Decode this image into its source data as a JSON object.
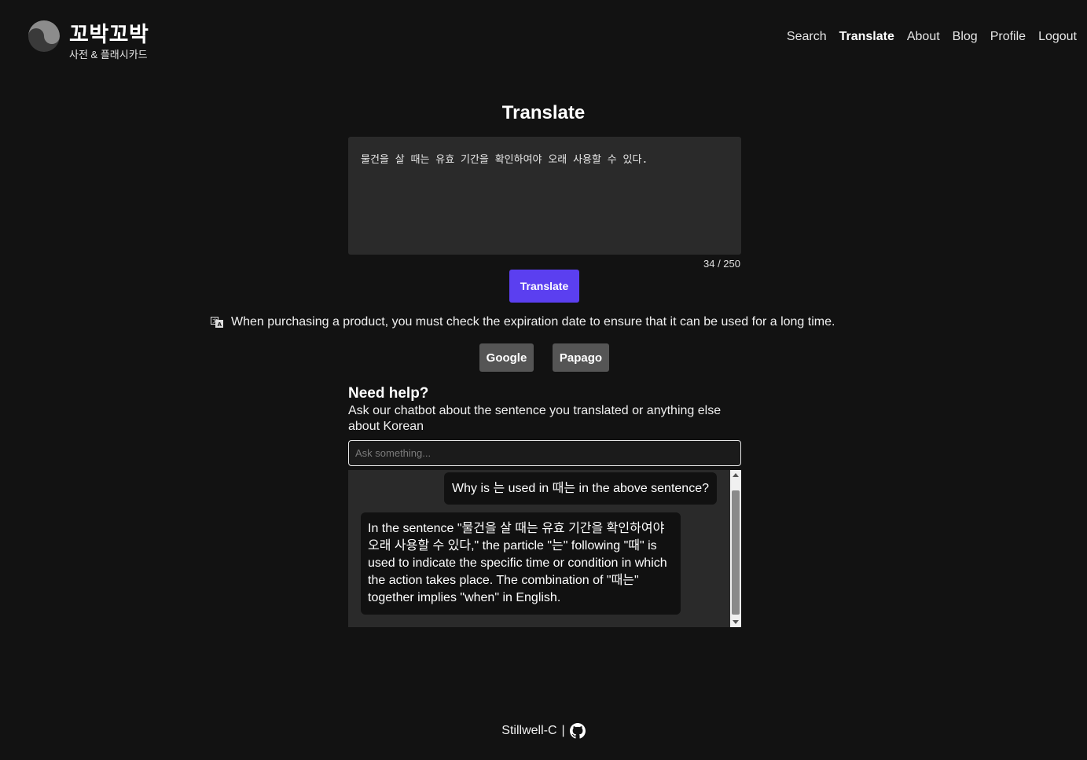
{
  "header": {
    "brand_title": "꼬박꼬박",
    "brand_subtitle": "사전 & 플래시카드",
    "nav": {
      "search": "Search",
      "translate": "Translate",
      "about": "About",
      "blog": "Blog",
      "profile": "Profile",
      "logout": "Logout"
    },
    "active_nav": "Translate"
  },
  "main": {
    "title": "Translate",
    "input_text": "물건을 살 때는 유효 기간을 확인하여야 오래 사용할 수 있다.",
    "char_counter": "34 / 250",
    "translate_button": "Translate",
    "translation_icon": "translate-icon",
    "translation_result": "When purchasing a product, you must check the expiration date to ensure that it can be used for a long time.",
    "service_buttons": {
      "google": "Google",
      "papago": "Papago"
    }
  },
  "help": {
    "title": "Need help?",
    "subtitle": "Ask our chatbot about the sentence you translated or anything else about Korean",
    "input_placeholder": "Ask something...",
    "messages": [
      {
        "role": "user",
        "text": "Why is 는 used in 때는 in the above sentence?"
      },
      {
        "role": "bot",
        "text": "In the sentence \"물건을 살 때는 유효 기간을 확인하여야 오래 사용할 수 있다,\" the particle \"는\" following \"때\" is used to indicate the specific time or condition in which the action takes place. The combination of \"때는\" together implies \"when\" in English."
      }
    ]
  },
  "footer": {
    "author": "Stillwell-C",
    "separator": "|",
    "icon": "github-icon"
  },
  "colors": {
    "background": "#121212",
    "accent": "#5b3ff0",
    "panel": "#2a2a2a",
    "service_button": "#555555"
  }
}
